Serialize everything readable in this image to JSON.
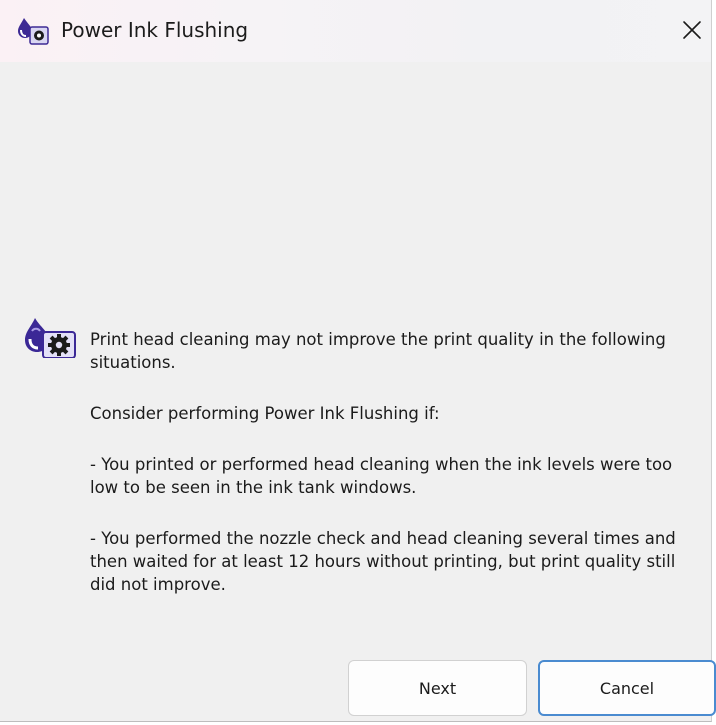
{
  "window": {
    "title": "Power Ink Flushing",
    "title_icon": "printer-maintenance-icon",
    "close_icon": "close-icon"
  },
  "message": {
    "icon": "ink-drop-gear-icon",
    "line1": "Print head cleaning may not improve the print quality in the following situations.",
    "line2": "Consider performing Power Ink Flushing if:",
    "line3": "- You printed or performed head cleaning when the ink levels were too low to be seen in the ink tank windows.",
    "line4": "- You performed the nozzle check and head cleaning several times and then waited for at least 12 hours without printing, but print quality still did not improve."
  },
  "buttons": {
    "next_label": "Next",
    "cancel_label": "Cancel"
  },
  "colors": {
    "window_bg": "#f0f0f0",
    "accent_border": "#4a8bd0",
    "icon_purple": "#4b2fa8"
  }
}
